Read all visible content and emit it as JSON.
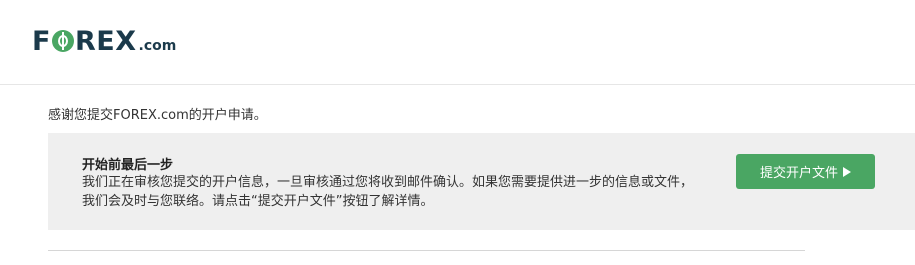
{
  "header": {
    "logo": {
      "part1": "F",
      "part2": "REX",
      "suffix": ".com"
    }
  },
  "main": {
    "thanks_text": "感谢您提交FOREX.com的开户申请。",
    "panel": {
      "title": "开始前最后一步",
      "body_lines": [
        "我们正在审核您提交的开户信息，一旦审核通过您将收到邮件确认。如果您需要提供进一步的信息或文件，",
        "我们会及时与您联络。请点击“提交开户文件”按钮了解详情。"
      ],
      "button_label": "提交开户文件"
    }
  },
  "colors": {
    "brand_dark": "#1b3a4b",
    "brand_green": "#4aa663",
    "panel_bg": "#efefef"
  },
  "icons": {
    "logo_o": "currency-circle-icon",
    "button_arrow": "play-triangle-icon"
  }
}
